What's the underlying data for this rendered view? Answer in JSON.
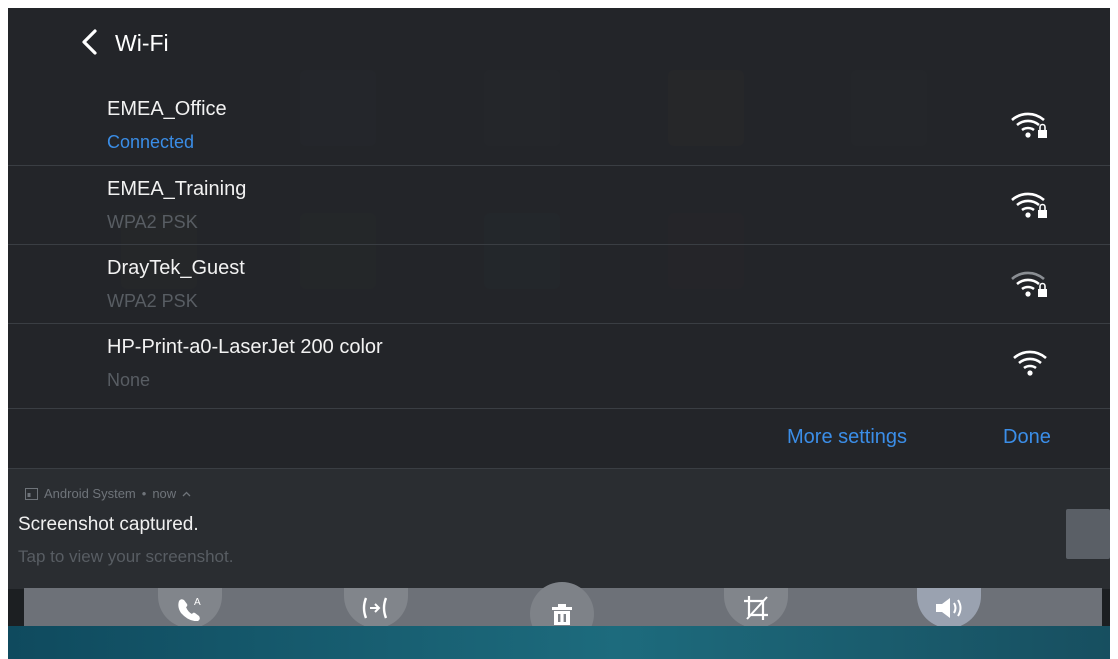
{
  "header": {
    "title": "Wi-Fi",
    "back_icon": "chevron-left-icon"
  },
  "networks": [
    {
      "name": "EMEA_Office",
      "status": "Connected",
      "secured": true,
      "signal": "full"
    },
    {
      "name": "EMEA_Training",
      "status": "WPA2 PSK",
      "secured": true,
      "signal": "full"
    },
    {
      "name": "DrayTek_Guest",
      "status": "WPA2 PSK",
      "secured": true,
      "signal": "medium"
    },
    {
      "name": "HP-Print-a0-LaserJet 200 color",
      "status": "None",
      "secured": false,
      "signal": "full"
    }
  ],
  "actions": {
    "more_settings": "More settings",
    "done": "Done"
  },
  "notification": {
    "app": "Android System",
    "time": "now",
    "title": "Screenshot captured.",
    "text": "Tap to view your screenshot."
  },
  "call_bar": {
    "buttons": [
      "auto-answer-icon",
      "transfer-icon",
      "delete-icon",
      "crop-icon",
      "volume-icon"
    ]
  },
  "colors": {
    "accent": "#3b8ee8",
    "panel_bg": "#23262a",
    "notification_bg": "#2a2d31",
    "call_bar_bg": "#6d7178"
  }
}
